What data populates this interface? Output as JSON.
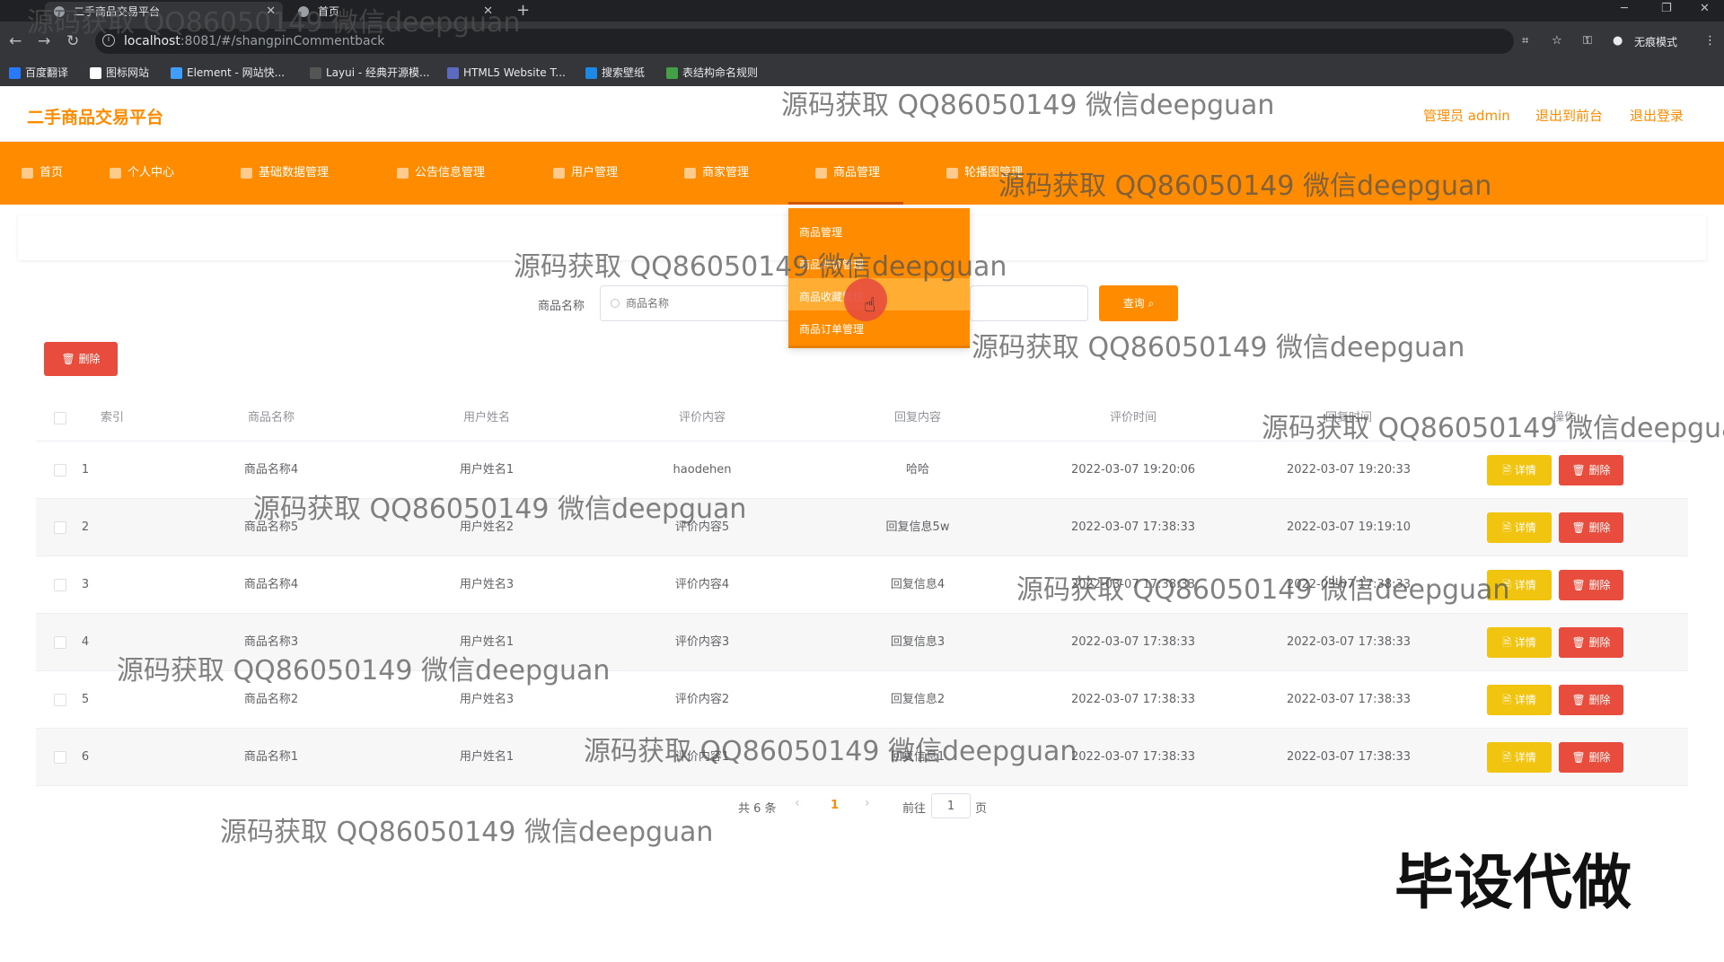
{
  "browser": {
    "tabs": [
      {
        "label": "二手商品交易平台",
        "active": true
      },
      {
        "label": "首页",
        "active": false
      }
    ],
    "url_host": "localhost",
    "url_path": ":8081/#/shangpinCommentback",
    "incognito_label": "无痕模式",
    "bookmarks": [
      "百度翻译",
      "图标网站",
      "Element - 网站快...",
      "Layui - 经典开源模...",
      "HTML5 Website T...",
      "搜索壁纸",
      "表结构命名规则"
    ]
  },
  "header": {
    "brand": "二手商品交易平台",
    "admin_label": "管理员 admin",
    "back_front": "退出到前台",
    "logout": "退出登录"
  },
  "nav": {
    "items": [
      "首页",
      "个人中心",
      "基础数据管理",
      "公告信息管理",
      "用户管理",
      "商家管理",
      "商品管理",
      "轮播图管理"
    ],
    "active_index": 6
  },
  "dropdown": {
    "items": [
      "商品管理",
      "商品评价管理",
      "商品收藏管理",
      "商品订单管理"
    ],
    "hovered_index": 2
  },
  "search": {
    "label": "商品名称",
    "placeholder": "商品名称",
    "button": "查询"
  },
  "toolbar": {
    "delete_label": "删除"
  },
  "table": {
    "columns": [
      "索引",
      "商品名称",
      "用户姓名",
      "评价内容",
      "回复内容",
      "评价时间",
      "回复时间",
      "操作"
    ],
    "rows": [
      {
        "index": "1",
        "name": "商品名称4",
        "user": "用户姓名1",
        "content": "haodehen",
        "reply": "哈哈",
        "comment_time": "2022-03-07 19:20:06",
        "reply_time": "2022-03-07 19:20:33"
      },
      {
        "index": "2",
        "name": "商品名称5",
        "user": "用户姓名2",
        "content": "评价内容5",
        "reply": "回复信息5w",
        "comment_time": "2022-03-07 17:38:33",
        "reply_time": "2022-03-07 19:19:10"
      },
      {
        "index": "3",
        "name": "商品名称4",
        "user": "用户姓名3",
        "content": "评价内容4",
        "reply": "回复信息4",
        "comment_time": "2022-03-07 17:38:33",
        "reply_time": "2022-03-07 17:38:33"
      },
      {
        "index": "4",
        "name": "商品名称3",
        "user": "用户姓名1",
        "content": "评价内容3",
        "reply": "回复信息3",
        "comment_time": "2022-03-07 17:38:33",
        "reply_time": "2022-03-07 17:38:33"
      },
      {
        "index": "5",
        "name": "商品名称2",
        "user": "用户姓名3",
        "content": "评价内容2",
        "reply": "回复信息2",
        "comment_time": "2022-03-07 17:38:33",
        "reply_time": "2022-03-07 17:38:33"
      },
      {
        "index": "6",
        "name": "商品名称1",
        "user": "用户姓名1",
        "content": "评价内容1",
        "reply": "回复信息1",
        "comment_time": "2022-03-07 17:38:33",
        "reply_time": "2022-03-07 17:38:33"
      }
    ],
    "detail_label": "详情",
    "delete_label": "删除"
  },
  "pagination": {
    "total": "共 6 条",
    "current_page": "1",
    "goto_label": "前往",
    "goto_value": "1",
    "page_unit": "页"
  },
  "watermark": "源码获取 QQ86050149 微信deepguan",
  "stamp": "毕设代做",
  "colors": {
    "accent": "#ff8c00",
    "danger": "#e74c3c",
    "warning": "#f1c40f"
  }
}
